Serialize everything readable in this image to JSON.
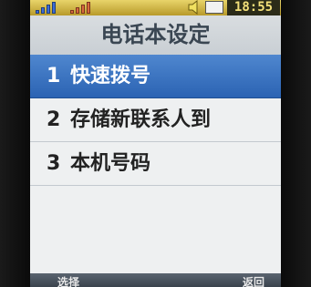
{
  "status": {
    "time": "18:55"
  },
  "header": {
    "title": "电话本设定"
  },
  "menu": {
    "items": [
      {
        "number": "1",
        "label": "快速拨号",
        "selected": true
      },
      {
        "number": "2",
        "label": "存储新联系人到",
        "selected": false
      },
      {
        "number": "3",
        "label": "本机号码",
        "selected": false
      }
    ]
  },
  "softkeys": {
    "left": "选择",
    "right": "返回"
  },
  "colors": {
    "accent": "#3a72c2",
    "title_text": "#3a4652"
  },
  "icons": [
    "signal-strength-icon",
    "network-signal-icon",
    "volume-icon",
    "battery-icon"
  ]
}
